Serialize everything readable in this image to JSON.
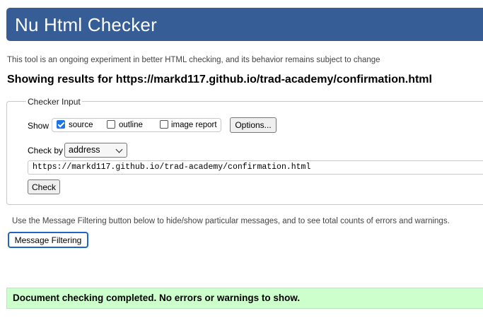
{
  "header": {
    "title": "Nu Html Checker"
  },
  "tagline": "This tool is an ongoing experiment in better HTML checking, and its behavior remains subject to change",
  "results_heading": "Showing results for https://markd117.github.io/trad-academy/confirmation.html",
  "checker_input": {
    "legend": "Checker Input",
    "show_label": "Show",
    "options": [
      {
        "label": "source",
        "checked": true
      },
      {
        "label": "outline",
        "checked": false
      },
      {
        "label": "image report",
        "checked": false
      }
    ],
    "options_button": "Options...",
    "check_by_label": "Check by",
    "check_by_value": "address",
    "url_value": "https://markd117.github.io/trad-academy/confirmation.html",
    "check_button": "Check"
  },
  "filtering": {
    "note": "Use the Message Filtering button below to hide/show particular messages, and to see total counts of errors and warnings.",
    "button": "Message Filtering"
  },
  "result": {
    "message": "Document checking completed. No errors or warnings to show."
  },
  "colors": {
    "banner": "#365d95",
    "success_bg": "#ccffcc",
    "checkbox_accent": "#1a73e8",
    "focus_ring": "#1f65c6"
  }
}
